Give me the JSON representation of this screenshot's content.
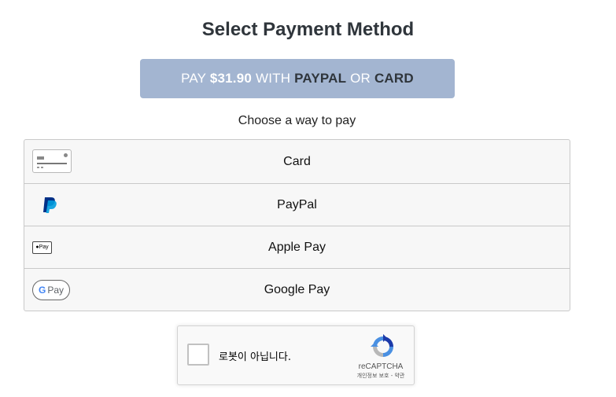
{
  "page": {
    "title": "Select Payment Method",
    "subtitle": "Choose a way to pay"
  },
  "pay_button": {
    "prefix": "PAY ",
    "amount": "$31.90",
    "with": " WITH ",
    "option1": "PAYPAL",
    "or": " OR ",
    "option2": "CARD"
  },
  "methods": [
    {
      "label": "Card",
      "icon": "credit-card-icon"
    },
    {
      "label": "PayPal",
      "icon": "paypal-icon"
    },
    {
      "label": "Apple Pay",
      "icon": "apple-pay-icon",
      "icon_text": "Pay"
    },
    {
      "label": "Google Pay",
      "icon": "google-pay-icon",
      "icon_text": "Pay",
      "icon_g": "G"
    }
  ],
  "recaptcha": {
    "label": "로봇이 아닙니다.",
    "brand": "reCAPTCHA",
    "links": "개인정보 보호 - 약관"
  },
  "colors": {
    "pay_button_bg": "#a3b5d1",
    "title_text": "#2f353b",
    "paypal_dark": "#003087",
    "paypal_light": "#009cde"
  }
}
